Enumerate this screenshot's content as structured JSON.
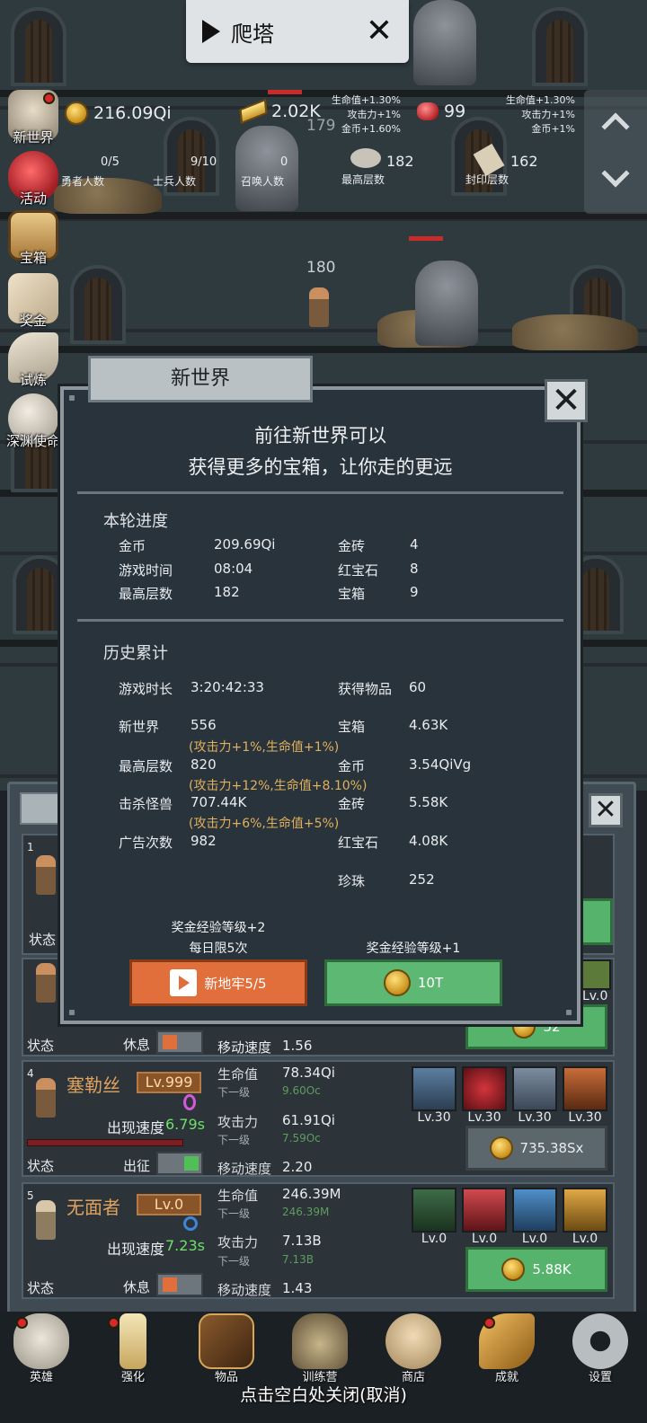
{
  "top_bar": {
    "title": "爬塔"
  },
  "resources": {
    "gold": "216.09Qi",
    "gold_bar": "2.02K",
    "ruby": "99",
    "gold_bar_bonus": [
      "生命值+1.30%",
      "攻击力+1%",
      "金币+1.60%"
    ],
    "ruby_bonus": [
      "生命值+1.30%",
      "攻击力+1%",
      "金币+1%"
    ]
  },
  "tower_stats": {
    "hero_count": {
      "value": "0/5",
      "label": "勇者人数"
    },
    "soldier_count": {
      "value": "9/10",
      "label": "士兵人数"
    },
    "summon_count": {
      "value": "0",
      "label": "召唤人数"
    },
    "max_floor": {
      "value": "182",
      "label": "最高层数"
    },
    "sealed_floor": {
      "value": "162",
      "label": "封印层数"
    }
  },
  "floor_numbers": [
    "179",
    "180"
  ],
  "side_menu": [
    "新世界",
    "活动",
    "宝箱",
    "奖金",
    "试炼",
    "深渊使命"
  ],
  "modal": {
    "title": "新世界",
    "intro_line1": "前往新世界可以",
    "intro_line2": "获得更多的宝箱，让你走的更远",
    "current_title": "本轮进度",
    "current": {
      "gold_k": "金币",
      "gold_v": "209.69Qi",
      "time_k": "游戏时间",
      "time_v": "08:04",
      "floor_k": "最高层数",
      "floor_v": "182",
      "bar_k": "金砖",
      "bar_v": "4",
      "ruby_k": "红宝石",
      "ruby_v": "8",
      "chest_k": "宝箱",
      "chest_v": "9"
    },
    "history_title": "历史累计",
    "history": {
      "duration_k": "游戏时长",
      "duration_v": "3:20:42:33",
      "newworld_k": "新世界",
      "newworld_v": "556",
      "newworld_bonus": "(攻击力+1%,生命值+1%)",
      "maxfloor_k": "最高层数",
      "maxfloor_v": "820",
      "maxfloor_bonus": "(攻击力+12%,生命值+8.10%)",
      "kills_k": "击杀怪兽",
      "kills_v": "707.44K",
      "kills_bonus": "(攻击力+6%,生命值+5%)",
      "ads_k": "广告次数",
      "ads_v": "982",
      "items_k": "获得物品",
      "items_v": "60",
      "chest_k": "宝箱",
      "chest_v": "4.63K",
      "gold_k": "金币",
      "gold_v": "3.54QiVg",
      "bar_k": "金砖",
      "bar_v": "5.58K",
      "ruby_k": "红宝石",
      "ruby_v": "4.08K",
      "pearl_k": "珍珠",
      "pearl_v": "252"
    },
    "offer_left_line1": "奖金经验等级+2",
    "offer_left_line2": "每日限5次",
    "offer_right": "奖金经验等级+1",
    "btn_ad": "新地牢5/5",
    "btn_gold": "10T"
  },
  "hero_list": {
    "card1": {
      "index": "1",
      "state_label": "状态"
    },
    "card2": {
      "state_label": "状态",
      "state": "休息",
      "speed_label": "移动速度",
      "speed": "1.56",
      "lv_small": "Lv.0",
      "cost": "52"
    },
    "card4": {
      "index": "4",
      "name": "塞勒丝",
      "level": "Lv.999",
      "appear_label": "出现速度",
      "appear": "6.79s",
      "hp_label": "生命值",
      "hp": "78.34Qi",
      "next_label": "下一级",
      "hp_next": "9.60Oc",
      "atk_label": "攻击力",
      "atk": "61.91Qi",
      "atk_next": "7.59Oc",
      "speed_label": "移动速度",
      "speed": "2.20",
      "state_label": "状态",
      "state": "出征",
      "equip_levels": [
        "Lv.30",
        "Lv.30",
        "Lv.30",
        "Lv.30"
      ],
      "cost": "735.38Sx",
      "hp_fraction": 0.83
    },
    "card5": {
      "index": "5",
      "name": "无面者",
      "level": "Lv.0",
      "appear_label": "出现速度",
      "appear": "7.23s",
      "hp_label": "生命值",
      "hp": "246.39M",
      "next_label": "下一级",
      "hp_next": "246.39M",
      "atk_label": "攻击力",
      "atk": "7.13B",
      "atk_next": "7.13B",
      "speed_label": "移动速度",
      "speed": "1.43",
      "state_label": "状态",
      "state": "休息",
      "equip_levels": [
        "Lv.0",
        "Lv.0",
        "Lv.0",
        "Lv.0"
      ],
      "cost": "5.88K"
    }
  },
  "bottom_nav": [
    "英雄",
    "强化",
    "物品",
    "训练营",
    "商店",
    "成就",
    "设置"
  ],
  "footer_hint": "点击空白处关闭(取消)",
  "colors": {
    "bonus_text": "#e0b15c",
    "orange_button": "#e06f3c",
    "green_button": "#5cb872",
    "next_level_text": "#5e9d5f"
  }
}
